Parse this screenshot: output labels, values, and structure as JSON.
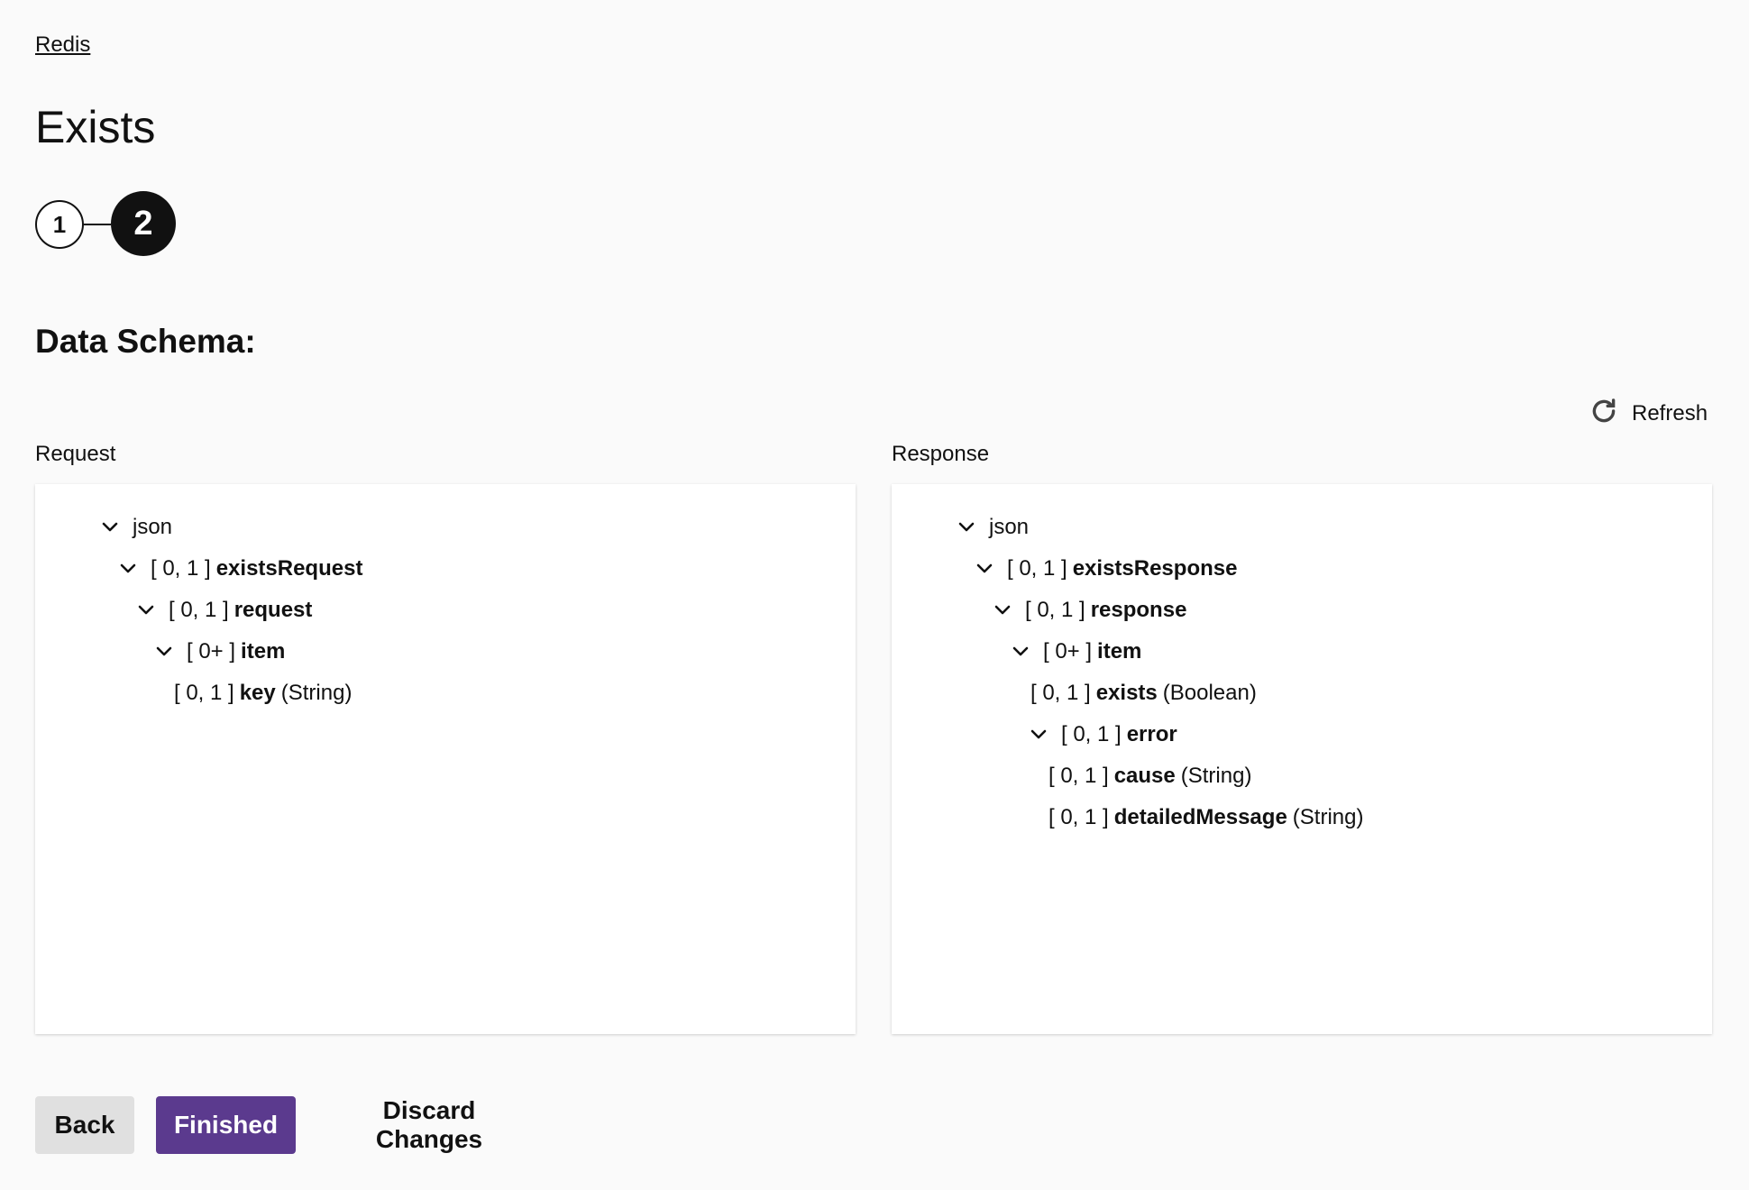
{
  "breadcrumb": "Redis",
  "title": "Exists",
  "stepper": {
    "steps": [
      {
        "label": "1",
        "state": "completed"
      },
      {
        "label": "2",
        "state": "current"
      }
    ]
  },
  "section_title": "Data Schema:",
  "refresh_label": "Refresh",
  "request": {
    "label": "Request",
    "rows": [
      {
        "chevron": true,
        "card": "",
        "name": "json",
        "type": ""
      },
      {
        "chevron": true,
        "card": "[ 0, 1 ]",
        "name": "existsRequest",
        "type": ""
      },
      {
        "chevron": true,
        "card": "[ 0, 1 ]",
        "name": "request",
        "type": ""
      },
      {
        "chevron": true,
        "card": "[ 0+ ]",
        "name": "item",
        "type": ""
      },
      {
        "chevron": false,
        "card": "[ 0, 1 ]",
        "name": "key",
        "type": "(String)"
      }
    ]
  },
  "response": {
    "label": "Response",
    "rows": [
      {
        "chevron": true,
        "card": "",
        "name": "json",
        "type": ""
      },
      {
        "chevron": true,
        "card": "[ 0, 1 ]",
        "name": "existsResponse",
        "type": ""
      },
      {
        "chevron": true,
        "card": "[ 0, 1 ]",
        "name": "response",
        "type": ""
      },
      {
        "chevron": true,
        "card": "[ 0+ ]",
        "name": "item",
        "type": ""
      },
      {
        "chevron": false,
        "card": "[ 0, 1 ]",
        "name": "exists",
        "type": "(Boolean)"
      },
      {
        "chevron": true,
        "card": "[ 0, 1 ]",
        "name": "error",
        "type": ""
      },
      {
        "chevron": false,
        "card": "[ 0, 1 ]",
        "name": "cause",
        "type": "(String)"
      },
      {
        "chevron": false,
        "card": "[ 0, 1 ]",
        "name": "detailedMessage",
        "type": "(String)"
      }
    ]
  },
  "buttons": {
    "back": "Back",
    "finished": "Finished",
    "discard": "Discard Changes"
  },
  "colors": {
    "primary": "#5b3a8e",
    "secondary_button": "#e0e0e0",
    "background": "#fafafa"
  },
  "icons": {
    "refresh": "refresh-icon",
    "expand": "chevron-down-icon"
  }
}
